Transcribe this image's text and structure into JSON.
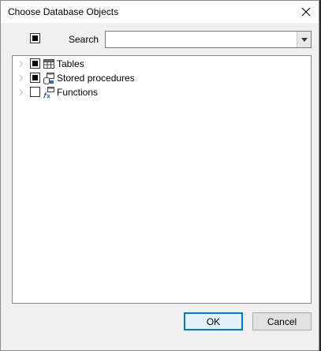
{
  "window": {
    "title": "Choose Database Objects"
  },
  "toolbar": {
    "search_label": "Search",
    "search_value": ""
  },
  "tree": {
    "items": [
      {
        "label": "Tables",
        "state": "partial",
        "icon": "table-icon"
      },
      {
        "label": "Stored procedures",
        "state": "partial",
        "icon": "stored-procedure-icon"
      },
      {
        "label": "Functions",
        "state": "unchecked",
        "icon": "function-icon"
      }
    ]
  },
  "buttons": {
    "ok_label": "OK",
    "cancel_label": "Cancel"
  },
  "colors": {
    "dialog_bg": "#f0f0f0",
    "accent": "#0078d7"
  }
}
